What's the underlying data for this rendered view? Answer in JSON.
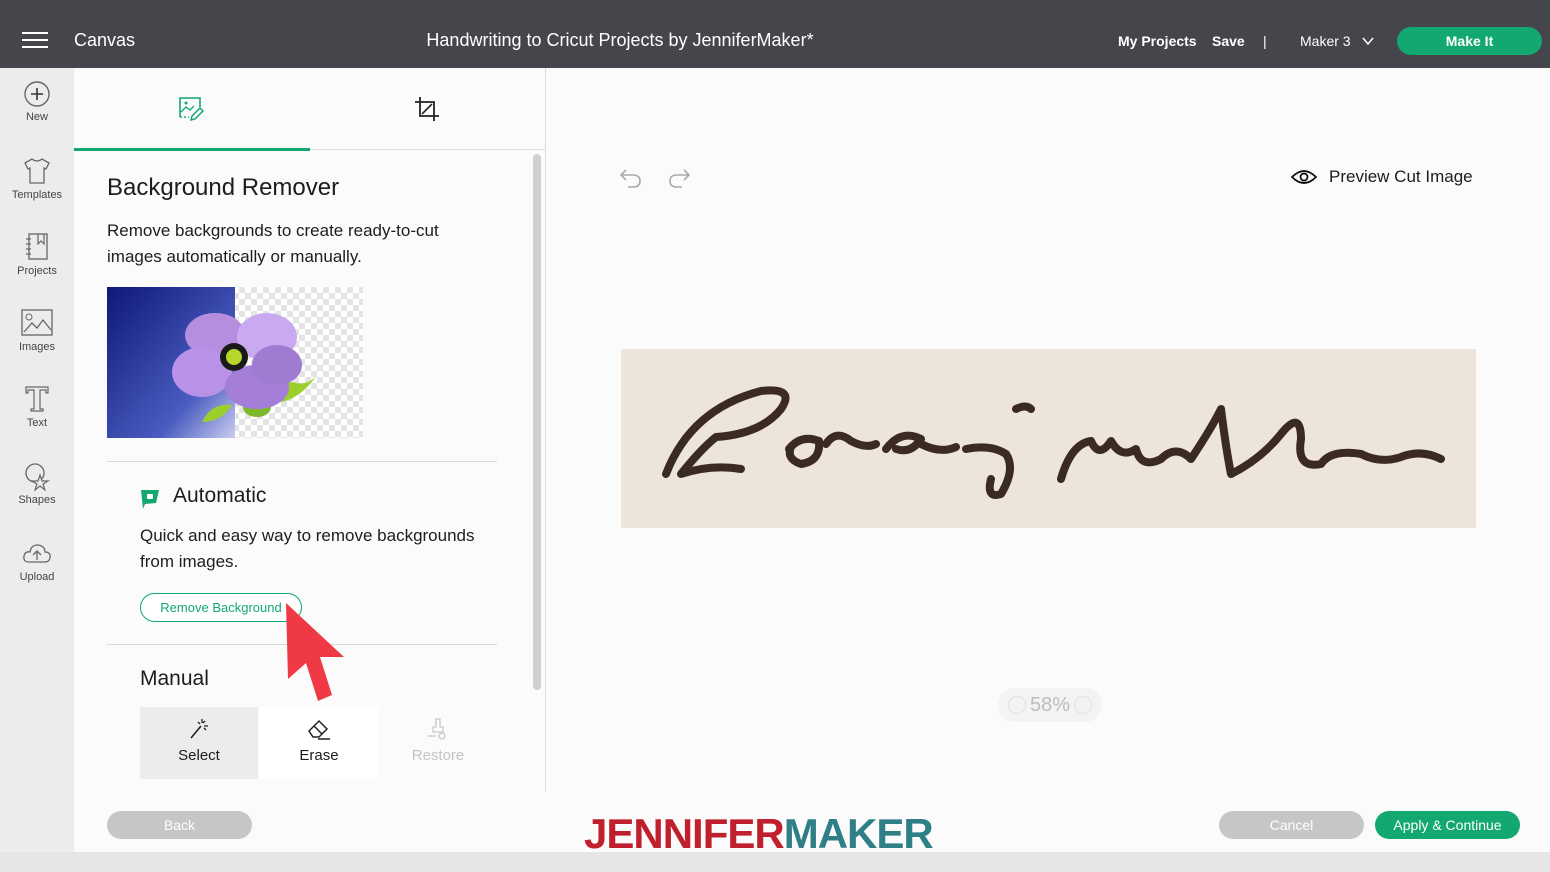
{
  "header": {
    "app_title": "Canvas",
    "doc_title": "Handwriting to Cricut Projects by JenniferMaker*",
    "my_projects": "My Projects",
    "save": "Save",
    "separator": "|",
    "machine": "Maker 3",
    "make_it": "Make It"
  },
  "sidebar": {
    "items": [
      {
        "label": "New",
        "icon": "plus-circle-icon"
      },
      {
        "label": "Templates",
        "icon": "tshirt-icon"
      },
      {
        "label": "Projects",
        "icon": "notebook-icon"
      },
      {
        "label": "Images",
        "icon": "image-icon"
      },
      {
        "label": "Text",
        "icon": "text-t-icon"
      },
      {
        "label": "Shapes",
        "icon": "shapes-icon"
      },
      {
        "label": "Upload",
        "icon": "cloud-upload-icon"
      }
    ]
  },
  "panel": {
    "tabs": [
      {
        "name": "background-remover",
        "icon": "image-edit-icon",
        "active": true
      },
      {
        "name": "crop",
        "icon": "crop-icon",
        "active": false
      }
    ],
    "title": "Background Remover",
    "description": "Remove backgrounds to create ready-to-cut images automatically or manually.",
    "automatic": {
      "title": "Automatic",
      "description": "Quick and easy way to remove backgrounds from images.",
      "button": "Remove Background"
    },
    "manual": {
      "title": "Manual",
      "tools": [
        {
          "label": "Select",
          "icon": "magic-wand-icon",
          "state": "selected"
        },
        {
          "label": "Erase",
          "icon": "eraser-icon",
          "state": "normal"
        },
        {
          "label": "Restore",
          "icon": "restore-brush-icon",
          "state": "disabled"
        }
      ]
    }
  },
  "canvas": {
    "preview_label": "Preview Cut Image",
    "zoom_level": "58%",
    "image_text": "Love mother"
  },
  "footer": {
    "back": "Back",
    "cancel": "Cancel",
    "apply": "Apply & Continue",
    "watermark_a": "JENNIFER",
    "watermark_b": "MAKER"
  },
  "colors": {
    "accent": "#12a870",
    "topbar": "#45454c",
    "watermark_red": "#c0202e",
    "watermark_teal": "#2f7f86"
  }
}
